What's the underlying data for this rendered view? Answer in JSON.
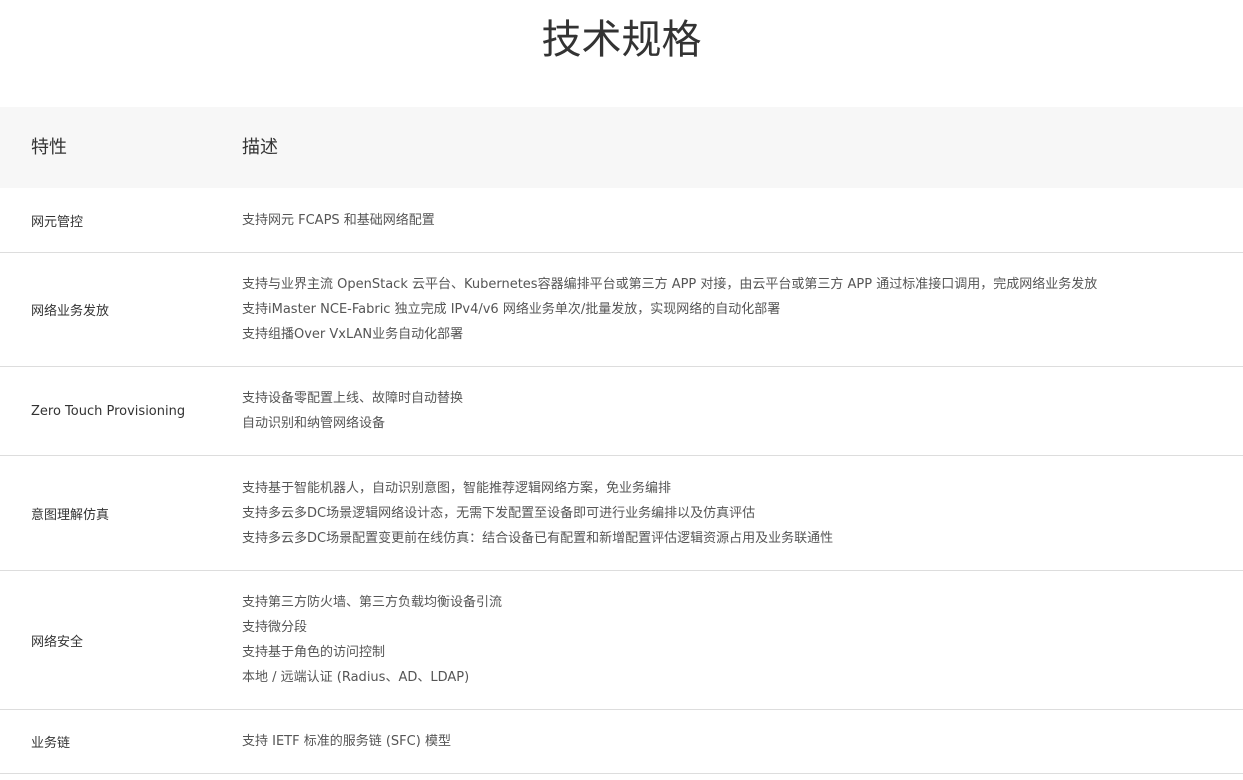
{
  "page": {
    "title": "技术规格"
  },
  "table": {
    "headers": {
      "feature": "特性",
      "description": "描述"
    },
    "rows": [
      {
        "feature": "网元管控",
        "lines": [
          "支持网元 FCAPS 和基础网络配置"
        ]
      },
      {
        "feature": "网络业务发放",
        "lines": [
          "支持与业界主流 OpenStack 云平台、Kubernetes容器编排平台或第三方 APP 对接，由云平台或第三方 APP 通过标准接口调用，完成网络业务发放",
          "支持iMaster NCE-Fabric 独立完成 IPv4/v6 网络业务单次/批量发放，实现网络的自动化部署",
          "支持组播Over VxLAN业务自动化部署"
        ]
      },
      {
        "feature": "Zero Touch Provisioning",
        "lines": [
          "支持设备零配置上线、故障时自动替换",
          "自动识别和纳管网络设备"
        ]
      },
      {
        "feature": "意图理解仿真",
        "lines": [
          "支持基于智能机器人，自动识别意图，智能推荐逻辑网络方案，免业务编排",
          "支持多云多DC场景逻辑网络设计态，无需下发配置至设备即可进行业务编排以及仿真评估",
          "支持多云多DC场景配置变更前在线仿真：结合设备已有配置和新增配置评估逻辑资源占用及业务联通性"
        ]
      },
      {
        "feature": "网络安全",
        "lines": [
          "支持第三方防火墙、第三方负载均衡设备引流",
          "支持微分段",
          "支持基于角色的访问控制",
          "本地 / 远端认证 (Radius、AD、LDAP)"
        ]
      },
      {
        "feature": "业务链",
        "lines": [
          "支持 IETF 标准的服务链 (SFC) 模型"
        ]
      }
    ]
  }
}
